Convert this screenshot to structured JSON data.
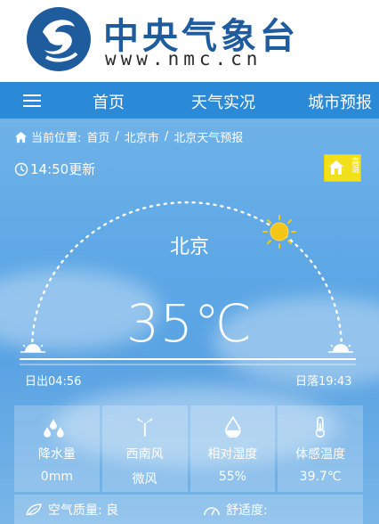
{
  "header": {
    "title": "中央气象台",
    "url": "www.nmc.cn"
  },
  "nav": {
    "items": [
      {
        "label": "首页"
      },
      {
        "label": "天气实况"
      },
      {
        "label": "城市预报"
      }
    ]
  },
  "breadcrumb": {
    "prefix": "当前位置:",
    "items": [
      "首页",
      "北京市",
      "北京天气预报"
    ]
  },
  "update_time": "14:50更新",
  "alert": {
    "text": "高温",
    "color": "#f2e01a"
  },
  "city": "北京",
  "temperature": "35℃",
  "sun": {
    "sunrise": "日出04:56",
    "sunset": "日落19:43"
  },
  "details": [
    {
      "icon": "rain-drops-icon",
      "label": "降水量",
      "value": "0mm"
    },
    {
      "icon": "wind-turbine-icon",
      "label": "西南风",
      "value": "微风"
    },
    {
      "icon": "water-drop-icon",
      "label": "相对湿度",
      "value": "55%"
    },
    {
      "icon": "thermometer-icon",
      "label": "体感温度",
      "value": "39.7℃"
    }
  ],
  "air": {
    "label": "空气质量: 良",
    "comfort": "舒适度:"
  },
  "colors": {
    "brand_blue": "#1f5c9e",
    "nav_blue": "#2b8ad8",
    "sky_blue": "#5ea8e6",
    "sun_yellow": "#f5c518"
  }
}
